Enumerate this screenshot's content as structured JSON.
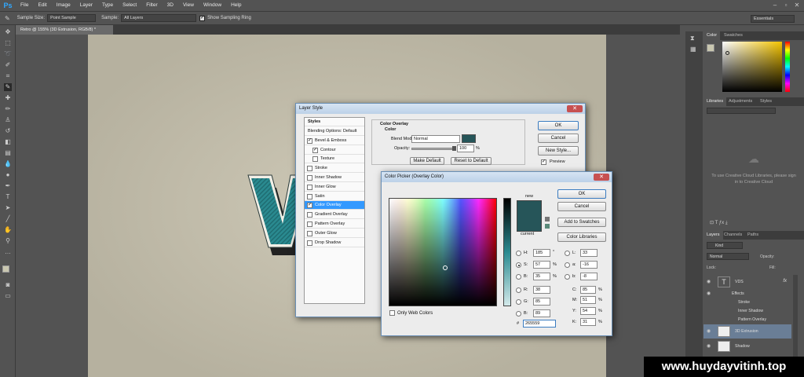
{
  "app": {
    "logo": "Ps"
  },
  "menu": [
    "File",
    "Edit",
    "Image",
    "Layer",
    "Type",
    "Select",
    "Filter",
    "3D",
    "View",
    "Window",
    "Help"
  ],
  "options_bar": {
    "sample_size_label": "Sample Size:",
    "sample_size_value": "Point Sample",
    "sample_label": "Sample:",
    "sample_value": "All Layers",
    "show_ring_label": "Show Sampling Ring",
    "workspace": "Essentials"
  },
  "document_tab": "Retro @ 155% (3D Extrusion, RGB/8) *",
  "colors": {
    "foreground": "#265559",
    "accent": "#3399ff",
    "letter": "#2a8a90"
  },
  "layer_style": {
    "title": "Layer Style",
    "styles_header": "Styles",
    "items": [
      {
        "label": "Blending Options: Default",
        "checkbox": false,
        "checked": false,
        "selected": false
      },
      {
        "label": "Bevel & Emboss",
        "checkbox": true,
        "checked": true,
        "selected": false
      },
      {
        "label": "Contour",
        "checkbox": true,
        "checked": true,
        "selected": false,
        "indent": true
      },
      {
        "label": "Texture",
        "checkbox": true,
        "checked": false,
        "selected": false,
        "indent": true
      },
      {
        "label": "Stroke",
        "checkbox": true,
        "checked": false,
        "selected": false
      },
      {
        "label": "Inner Shadow",
        "checkbox": true,
        "checked": false,
        "selected": false
      },
      {
        "label": "Inner Glow",
        "checkbox": true,
        "checked": false,
        "selected": false
      },
      {
        "label": "Satin",
        "checkbox": true,
        "checked": false,
        "selected": false
      },
      {
        "label": "Color Overlay",
        "checkbox": true,
        "checked": true,
        "selected": true
      },
      {
        "label": "Gradient Overlay",
        "checkbox": true,
        "checked": false,
        "selected": false
      },
      {
        "label": "Pattern Overlay",
        "checkbox": true,
        "checked": false,
        "selected": false
      },
      {
        "label": "Outer Glow",
        "checkbox": true,
        "checked": false,
        "selected": false
      },
      {
        "label": "Drop Shadow",
        "checkbox": true,
        "checked": false,
        "selected": false
      }
    ],
    "section_title": "Color Overlay",
    "group_title": "Color",
    "blend_mode_label": "Blend Mode:",
    "blend_mode_value": "Normal",
    "opacity_label": "Opacity:",
    "opacity_value": "100",
    "opacity_unit": "%",
    "opacity_level": 1.0,
    "make_default": "Make Default",
    "reset_default": "Reset to Default",
    "ok": "OK",
    "cancel": "Cancel",
    "new_style": "New Style...",
    "preview": "Preview"
  },
  "color_picker": {
    "title": "Color Picker (Overlay Color)",
    "new_label": "new",
    "current_label": "current",
    "ok": "OK",
    "cancel": "Cancel",
    "add_swatches": "Add to Swatches",
    "color_libraries": "Color Libraries",
    "only_web": "Only Web Colors",
    "H": {
      "label": "H:",
      "value": "185",
      "unit": "°"
    },
    "S": {
      "label": "S:",
      "value": "57",
      "unit": "%"
    },
    "Bv": {
      "label": "B:",
      "value": "35",
      "unit": "%"
    },
    "R": {
      "label": "R:",
      "value": "38"
    },
    "G": {
      "label": "G:",
      "value": "85"
    },
    "B": {
      "label": "B:",
      "value": "89"
    },
    "L": {
      "label": "L:",
      "value": "33"
    },
    "a": {
      "label": "a:",
      "value": "-16"
    },
    "b": {
      "label": "b:",
      "value": "-8"
    },
    "C": {
      "label": "C:",
      "value": "85",
      "unit": "%"
    },
    "M": {
      "label": "M:",
      "value": "51",
      "unit": "%"
    },
    "Y": {
      "label": "Y:",
      "value": "54",
      "unit": "%"
    },
    "K": {
      "label": "K:",
      "value": "31",
      "unit": "%"
    },
    "hex_label": "#",
    "hex": "265559"
  },
  "right_panels": {
    "color_tab": "Color",
    "swatches_tab": "Swatches",
    "libraries_tab": "Libraries",
    "adjustments_tab": "Adjustments",
    "styles_tab": "Styles",
    "cc_message": "To use Creative Cloud Libraries, please sign in to Creative Cloud",
    "layers_tab": "Layers",
    "channels_tab": "Channels",
    "paths_tab": "Paths",
    "kind_label": "Kind",
    "blend": "Normal",
    "opacity_label": "Opacity:",
    "lock_label": "Lock:",
    "fill_label": "Fill:",
    "layers": [
      {
        "name": "VDS",
        "type": "text",
        "fx": "fx"
      },
      {
        "name": "Effects",
        "type": "effects-header"
      },
      {
        "name": "Stroke",
        "type": "effect"
      },
      {
        "name": "Inner Shadow",
        "type": "effect"
      },
      {
        "name": "Pattern Overlay",
        "type": "effect"
      },
      {
        "name": "3D Extrusion",
        "type": "image",
        "selected": true
      },
      {
        "name": "Shadow",
        "type": "image"
      }
    ]
  },
  "watermark": "www.huydayvitinh.top"
}
